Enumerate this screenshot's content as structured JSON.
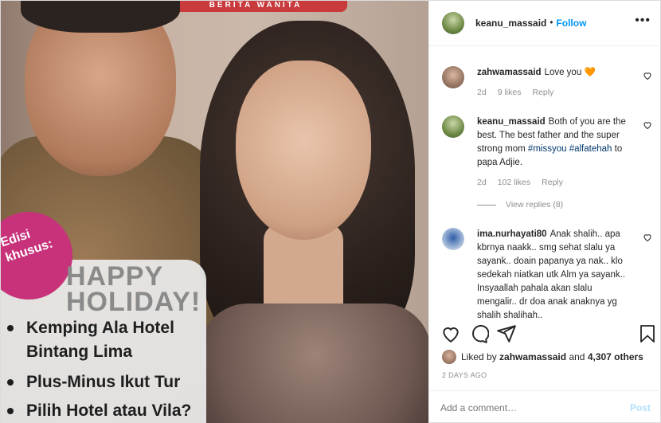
{
  "photo": {
    "masthead": "BERITA WANITA",
    "badge": "Edisi\nkhusus:",
    "headline": "HAPPY\nHOLIDAY!",
    "bullets": [
      "Kemping Ala Hotel",
      "Bintang Lima",
      "Plus-Minus Ikut Tur",
      "Pilih Hotel atau Vila?"
    ]
  },
  "header": {
    "username": "keanu_massaid",
    "separator": "•",
    "follow_label": "Follow",
    "more_label": "•••"
  },
  "comments": [
    {
      "user": "zahwamassaid",
      "text": "Love you",
      "emoji": "🧡",
      "age": "2d",
      "likes": "9 likes",
      "reply": "Reply"
    },
    {
      "user": "keanu_massaid",
      "text": "Both of you are the best. The best father and the super strong mom",
      "tags": [
        "#missyou",
        "#alfatehah"
      ],
      "tail": "to papa Adjie.",
      "age": "2d",
      "likes": "102 likes",
      "reply": "Reply"
    },
    {
      "user": "ima.nurhayati80",
      "text": "Anak shalih.. apa kbrnya naakk.. smg sehat slalu ya sayank.. doain papanya ya nak.. klo sedekah niatkan utk Alm ya sayank.. Insyaallah pahala akan slalu mengalir.. dr doa anak anaknya yg shalih shalihah.."
    }
  ],
  "view_replies": "View replies (8)",
  "liked_by": {
    "prefix": "Liked by",
    "user": "zahwamassaid",
    "and": "and",
    "count": "4,307 others"
  },
  "timestamp": "2 DAYS AGO",
  "comment_box": {
    "placeholder": "Add a comment…",
    "post_label": "Post"
  },
  "colors": {
    "accent": "#0095f6",
    "post_disabled": "#b2dffc",
    "heart": "#ed4956",
    "secondary": "#8e8e8e"
  }
}
